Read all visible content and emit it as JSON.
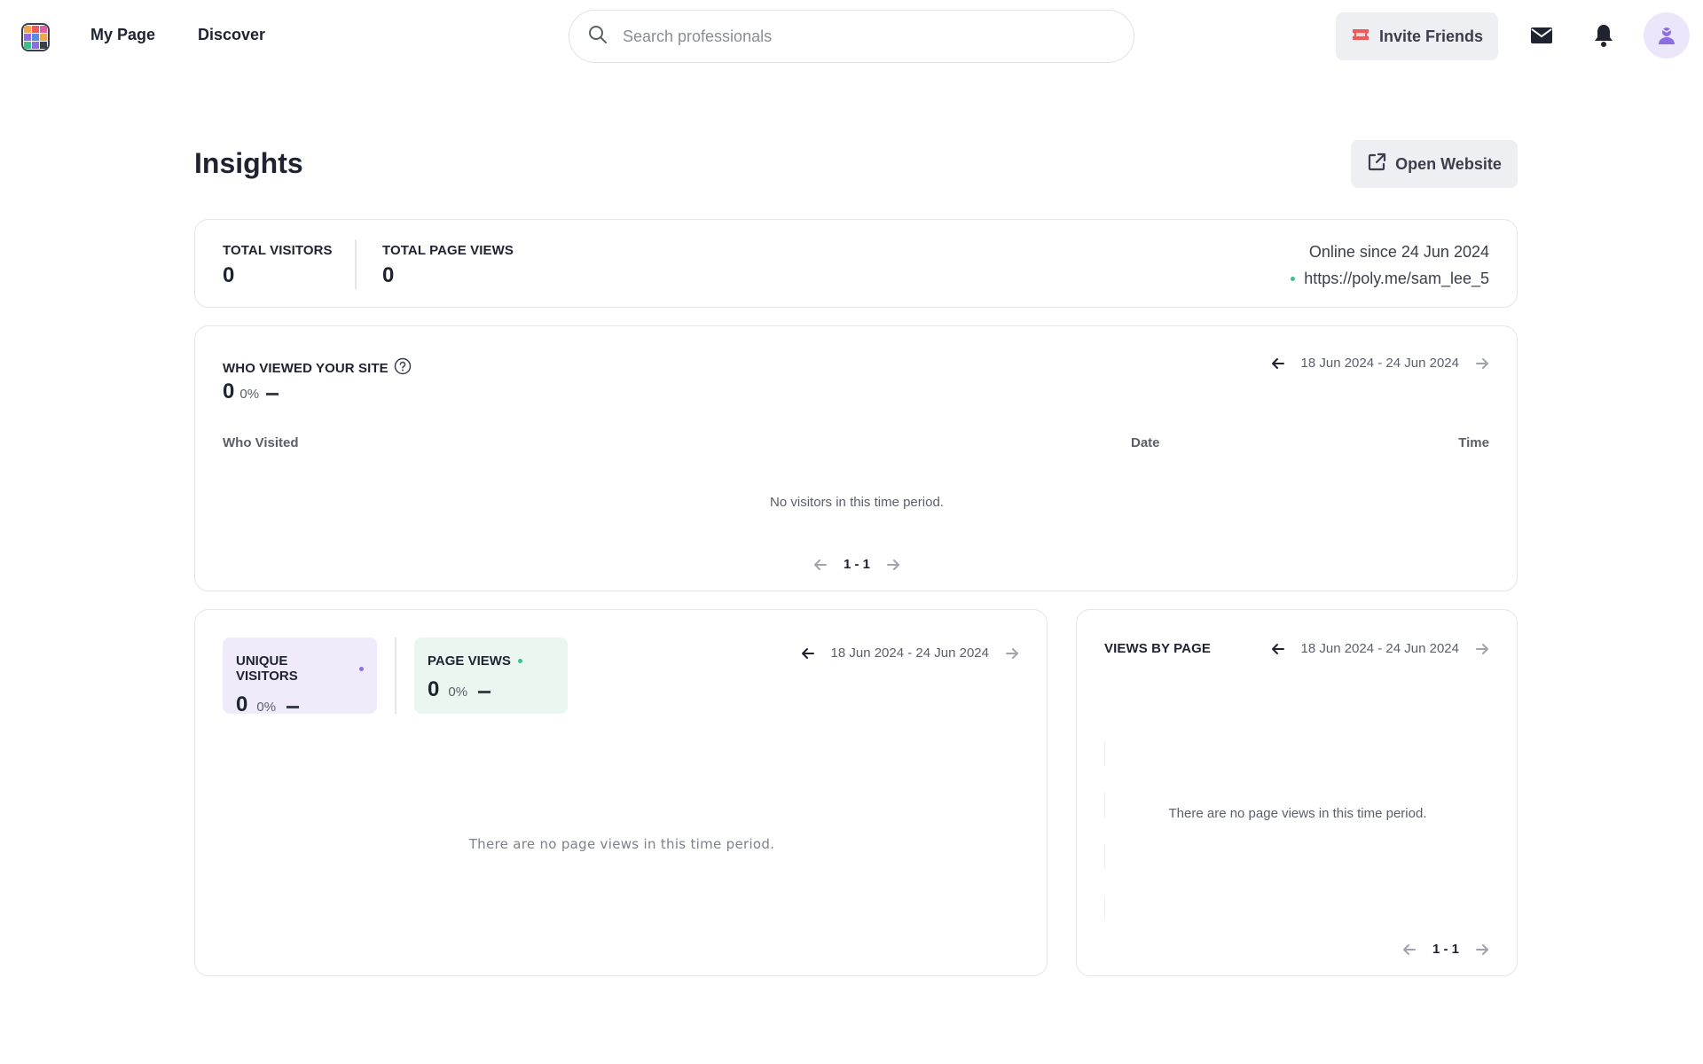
{
  "nav": {
    "my_page": "My Page",
    "discover": "Discover",
    "search_placeholder": "Search professionals",
    "invite_label": "Invite Friends",
    "icons": [
      "app-logo-icon",
      "search-icon",
      "ticket-icon",
      "mail-icon",
      "bell-icon",
      "user-avatar-icon"
    ]
  },
  "header": {
    "title": "Insights",
    "open_website": "Open Website"
  },
  "summary": {
    "total_visitors_label": "TOTAL VISITORS",
    "total_visitors": "0",
    "total_page_views_label": "TOTAL PAGE VIEWS",
    "total_page_views": "0",
    "online_since": "Online since 24 Jun 2024",
    "url": "https://poly.me/sam_lee_5"
  },
  "who_viewed": {
    "title": "WHO VIEWED YOUR SITE",
    "count": "0",
    "change": "0%",
    "date_range": "18 Jun 2024 - 24 Jun 2024",
    "columns": [
      "Who Visited",
      "Date",
      "Time"
    ],
    "empty": "No visitors in this time period.",
    "pager": "1 - 1"
  },
  "visits": {
    "unique_label": "UNIQUE VISITORS",
    "unique_count": "0",
    "unique_change": "0%",
    "page_views_label": "PAGE VIEWS",
    "page_views_count": "0",
    "page_views_change": "0%",
    "date_range": "18 Jun 2024 - 24 Jun 2024",
    "empty": "There are no page views in this time period."
  },
  "by_page": {
    "title": "VIEWS BY PAGE",
    "date_range": "18 Jun 2024 - 24 Jun 2024",
    "empty": "There are no page views in this time period.",
    "pager": "1 - 1"
  },
  "colors": {
    "accent_purple": "#8b6fe0",
    "accent_green": "#3fbf8a",
    "tile_purple_bg": "#efebfb",
    "tile_green_bg": "#eaf7f1",
    "invite_icon": "#f05a5a"
  }
}
